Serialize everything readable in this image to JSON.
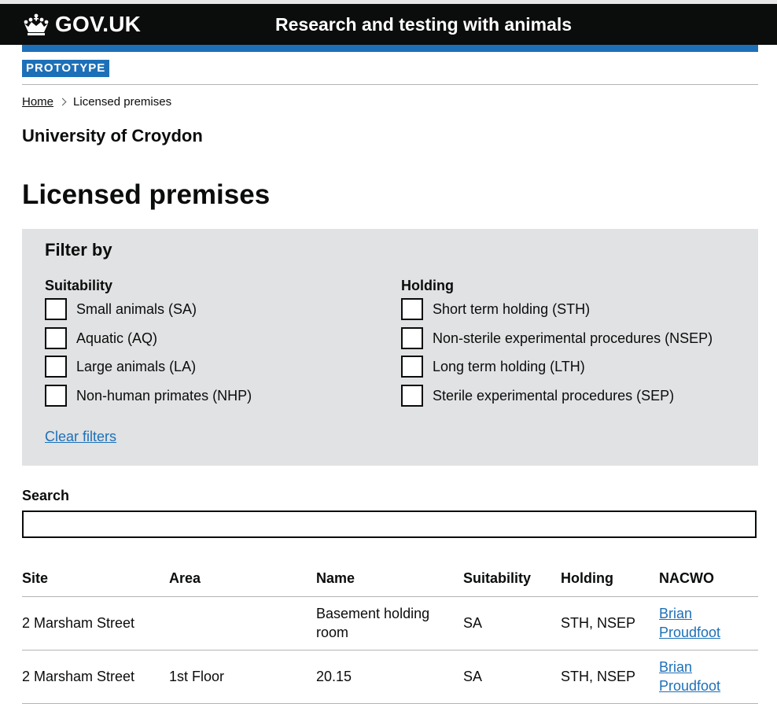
{
  "header": {
    "logo_text": "GOV.UK",
    "service_name": "Research and testing with animals",
    "phase_tag": "PROTOTYPE"
  },
  "breadcrumb": {
    "home": "Home",
    "current": "Licensed premises"
  },
  "org_name": "University of Croydon",
  "page_title": "Licensed premises",
  "filter": {
    "title": "Filter by",
    "suitability": {
      "label": "Suitability",
      "options": [
        "Small animals (SA)",
        "Aquatic (AQ)",
        "Large animals (LA)",
        "Non-human primates (NHP)"
      ]
    },
    "holding": {
      "label": "Holding",
      "options": [
        "Short term holding (STH)",
        "Non-sterile experimental procedures (NSEP)",
        "Long term holding (LTH)",
        "Sterile experimental procedures (SEP)"
      ]
    },
    "clear_label": "Clear filters"
  },
  "search": {
    "label": "Search",
    "value": ""
  },
  "table": {
    "headers": [
      "Site",
      "Area",
      "Name",
      "Suitability",
      "Holding",
      "NACWO"
    ],
    "rows": [
      {
        "site": "2 Marsham Street",
        "area": "",
        "name_line1": "Basement holding",
        "name_line2": "room",
        "suitability": "SA",
        "holding": "STH, NSEP",
        "nacwo_line1": "Brian",
        "nacwo_line2": "Proudfoot"
      },
      {
        "site": "2 Marsham Street",
        "area": "1st Floor",
        "name_line1": "20.15",
        "name_line2": "",
        "suitability": "SA",
        "holding": "STH, NSEP",
        "nacwo_line1": "Brian",
        "nacwo_line2": "Proudfoot"
      }
    ]
  },
  "colors": {
    "header": "#0b0c0c",
    "brand_blue": "#1d70b8",
    "panel": "#e0e2e3",
    "link": "#1d70b8"
  }
}
